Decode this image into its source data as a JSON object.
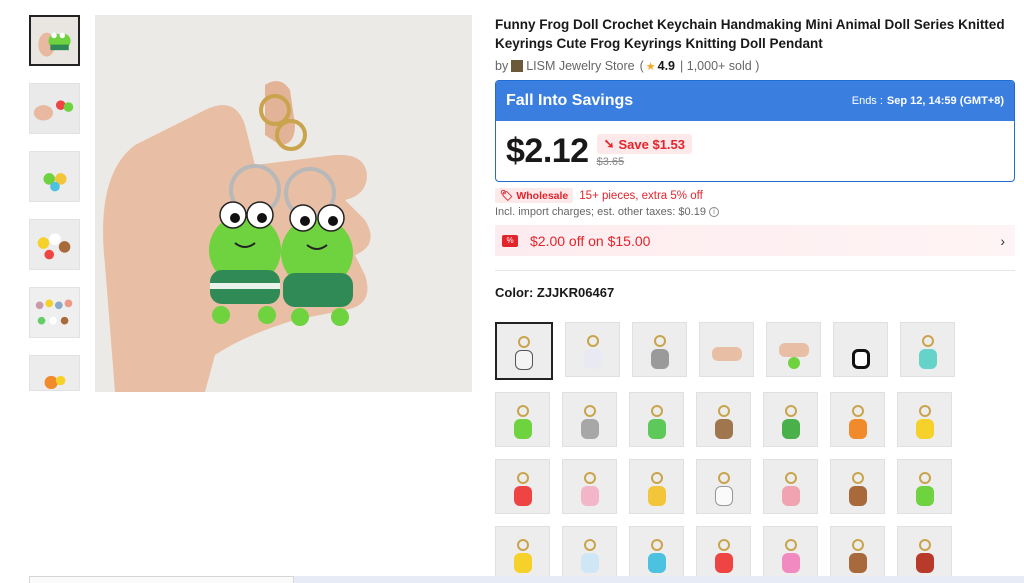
{
  "product": {
    "title": "Funny Frog Doll Crochet Keychain Handmaking Mini Animal Doll Series Knitted Keyrings Cute Frog Keyrings Knitting Doll Pendant",
    "by_prefix": "by",
    "store_name": "LISM Jewelry Store",
    "rating_open": "(",
    "rating": "4.9",
    "sold": "| 1,000+ sold )"
  },
  "promo": {
    "title": "Fall Into Savings",
    "ends_label": "Ends :",
    "ends_date": "Sep 12, 14:59 (GMT+8)",
    "price": "$2.12",
    "save_label": "Save $1.53",
    "old_price": "$3.65",
    "colors": {
      "header": "#3a7fe0",
      "accent_red": "#e3242b"
    }
  },
  "wholesale": {
    "tag": "Wholesale",
    "text": "15+ pieces, extra 5% off"
  },
  "import_note": "Incl. import charges; est. other taxes: $0.19",
  "coupon": {
    "text": "$2.00 off on $15.00"
  },
  "color_selector": {
    "label": "Color: ZJJKR06467"
  },
  "icons": {
    "star": "star-icon",
    "save_arrow": "arrow-down-icon",
    "wholesale": "tag-icon",
    "info": "info-icon",
    "coupon": "coupon-icon",
    "chevron": "chevron-right-icon"
  }
}
